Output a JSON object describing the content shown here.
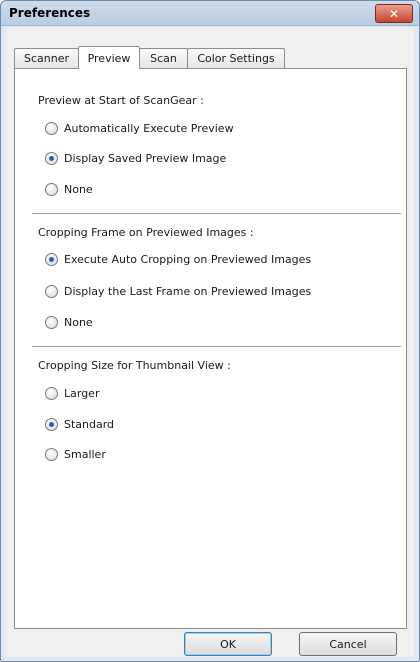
{
  "window": {
    "title": "Preferences"
  },
  "tabs": [
    {
      "label": "Scanner"
    },
    {
      "label": "Preview"
    },
    {
      "label": "Scan"
    },
    {
      "label": "Color Settings"
    }
  ],
  "sections": [
    {
      "label": "Preview at Start of ScanGear :",
      "options": [
        {
          "label": "Automatically Execute Preview",
          "checked": false
        },
        {
          "label": "Display Saved Preview Image",
          "checked": true
        },
        {
          "label": "None",
          "checked": false
        }
      ]
    },
    {
      "label": "Cropping Frame on Previewed Images :",
      "options": [
        {
          "label": "Execute Auto Cropping on Previewed Images",
          "checked": true
        },
        {
          "label": "Display the Last Frame on Previewed Images",
          "checked": false
        },
        {
          "label": "None",
          "checked": false
        }
      ]
    },
    {
      "label": "Cropping Size for Thumbnail View :",
      "options": [
        {
          "label": "Larger",
          "checked": false
        },
        {
          "label": "Standard",
          "checked": true
        },
        {
          "label": "Smaller",
          "checked": false
        }
      ]
    }
  ],
  "buttons": {
    "ok": "OK",
    "cancel": "Cancel"
  },
  "icons": {
    "close": "close-icon"
  },
  "colors": {
    "title_bar": "#c4d4e8",
    "close_button": "#c8452f",
    "radio_selected": "#1f5fc2"
  }
}
